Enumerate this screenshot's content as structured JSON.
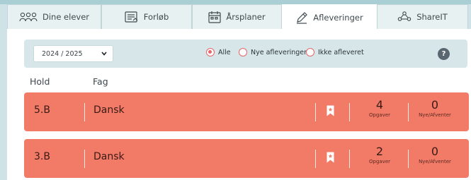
{
  "tabs": [
    {
      "label": "Dine elever",
      "icon": "students-icon",
      "active": false
    },
    {
      "label": "Forløb",
      "icon": "document-list-icon",
      "active": false
    },
    {
      "label": "Årsplaner",
      "icon": "calendar-icon",
      "active": false
    },
    {
      "label": "Afleveringer",
      "icon": "pen-icon",
      "active": true
    },
    {
      "label": "ShareIT",
      "icon": "share-network-icon",
      "active": false
    }
  ],
  "filter": {
    "year": "2024 / 2025",
    "options": [
      {
        "label": "Alle",
        "selected": true
      },
      {
        "label": "Nye afleveringer",
        "selected": false
      },
      {
        "label": "Ikke afleveret",
        "selected": false
      }
    ],
    "help": "?"
  },
  "columns": {
    "hold": "Hold",
    "fag": "Fag"
  },
  "rows": [
    {
      "hold": "5.B",
      "fag": "Dansk",
      "opgaver": "4",
      "opgaver_label": "Opgaver",
      "nye": "0",
      "nye_label": "Nye/Afventer"
    },
    {
      "hold": "3.B",
      "fag": "Dansk",
      "opgaver": "2",
      "opgaver_label": "Opgaver",
      "nye": "0",
      "nye_label": "Nye/Afventer"
    }
  ],
  "colors": {
    "background": "#cfe3e6",
    "row": "#f27b68",
    "radio_accent": "#e8656a"
  }
}
